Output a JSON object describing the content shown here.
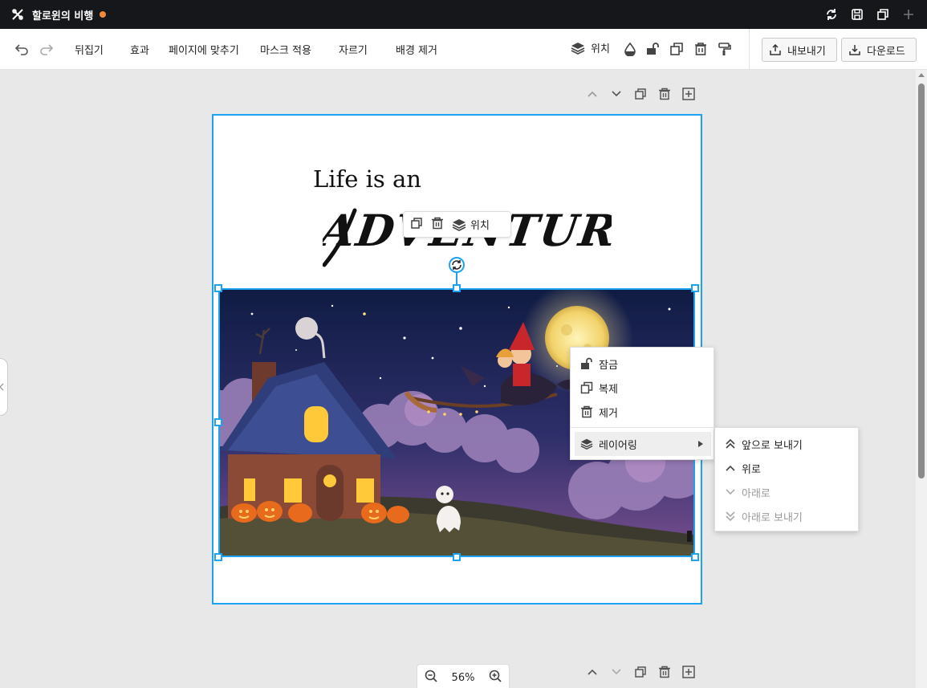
{
  "app": {
    "title": "할로윈의 비행",
    "unsaved_indicator_color": "#f08a3c",
    "header_icons": [
      "refresh-icon",
      "save-icon",
      "duplicate-icon",
      "plus-icon"
    ]
  },
  "toolbar": {
    "undo_icon": "undo-icon",
    "redo_icon": "redo-icon",
    "flip_label": "뒤집기",
    "effects_label": "효과",
    "fit_page_label": "페이지에 맞추기",
    "mask_label": "마스크 적용",
    "crop_label": "자르기",
    "remove_bg_label": "배경 제거",
    "position_label": "위치",
    "export_label": "내보내기",
    "download_label": "다운로드"
  },
  "canvas": {
    "headline": "Life is an",
    "script_text": "ADVENTURE",
    "element_toolbar": {
      "position_label": "위치"
    },
    "selection_color": "#1ba3f2"
  },
  "context_menu": {
    "items": [
      {
        "label": "잠금",
        "icon": "unlock-icon"
      },
      {
        "label": "복제",
        "icon": "duplicate-icon"
      },
      {
        "label": "제거",
        "icon": "trash-icon"
      },
      {
        "label": "레이어링",
        "icon": "layers-icon",
        "has_submenu": true
      }
    ],
    "submenu": [
      {
        "label": "앞으로 보내기",
        "icon": "double-chevron-up-icon",
        "enabled": true
      },
      {
        "label": "위로",
        "icon": "chevron-up-icon",
        "enabled": true
      },
      {
        "label": "아래로",
        "icon": "chevron-down-icon",
        "enabled": false
      },
      {
        "label": "아래로 보내기",
        "icon": "double-chevron-down-icon",
        "enabled": false
      }
    ]
  },
  "zoom": {
    "level": "56%"
  }
}
